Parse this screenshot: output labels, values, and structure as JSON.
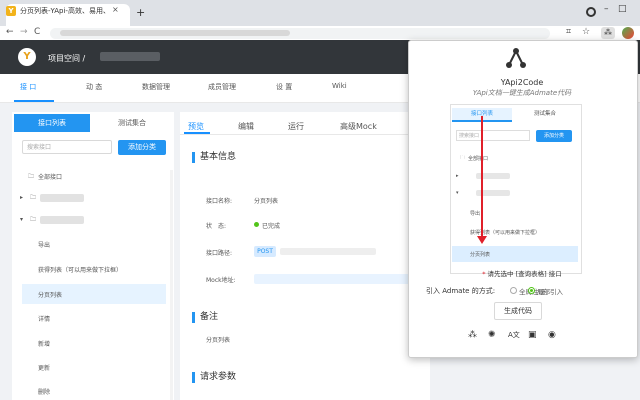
{
  "browser": {
    "tab_title": "分页列表-YApi-高效、易用、功能...",
    "tab_favicon": "Y",
    "close_glyph": "×",
    "new_tab_glyph": "+",
    "back_glyph": "←",
    "forward_glyph": "→",
    "reload_glyph": "C",
    "minimize_glyph": "–",
    "maximize_glyph": "□",
    "ext_icons": [
      "qr-scan-icon",
      "star-icon",
      "yapi2code-extension-icon",
      "avatar"
    ]
  },
  "app": {
    "logo_glyph": "Y",
    "project_label": "项目空间 /",
    "main_tabs": [
      "接 口",
      "动 态",
      "数据管理",
      "成员管理",
      "设 置",
      "Wiki"
    ],
    "accent": "#2395f1"
  },
  "sidebar": {
    "tab_active": "接口列表",
    "tab_2": "测试集合",
    "search_placeholder": "搜索接口",
    "add_category": "添加分类",
    "all_interfaces": "全部接口",
    "items": [
      "导出",
      "获得列表（可以用来做下拉框）",
      "分页列表",
      "详情",
      "新增",
      "更新",
      "删除"
    ],
    "selected": "分页列表"
  },
  "content": {
    "tabs": [
      "预览",
      "编辑",
      "运行",
      "高级Mock"
    ],
    "active_tab": "预览",
    "section_basic": "基本信息",
    "label_name": "接口名称:",
    "value_name": "分页列表",
    "label_status": "状　态:",
    "value_status": "已完成",
    "label_path": "接口路径:",
    "value_method": "POST",
    "label_mock": "Mock地址:",
    "section_remark": "备注",
    "value_remark": "分页列表",
    "section_params": "请求参数"
  },
  "popup": {
    "title": "YApi2Code",
    "subtitle": "YApi文档一键生成Admate代码",
    "shot_tab_active": "接口列表",
    "shot_tab_2": "测试集合",
    "shot_search": "搜索接口",
    "shot_add": "添加分类",
    "shot_all": "全部接口",
    "shot_items": [
      "导出",
      "获得列表（可以用来做下拉框）",
      "分页列表"
    ],
    "hint_star": "*",
    "hint": "请先选中 [查询表格] 接口",
    "mode_label": "引入 Admate 的方式:",
    "mode_options": [
      "全局注册",
      "局部引入"
    ],
    "mode_selected": "局部引入",
    "generate_button": "生成代码",
    "footer_icons": [
      "share-icon",
      "settings-icon",
      "translate-icon",
      "window-icon",
      "github-icon"
    ]
  }
}
